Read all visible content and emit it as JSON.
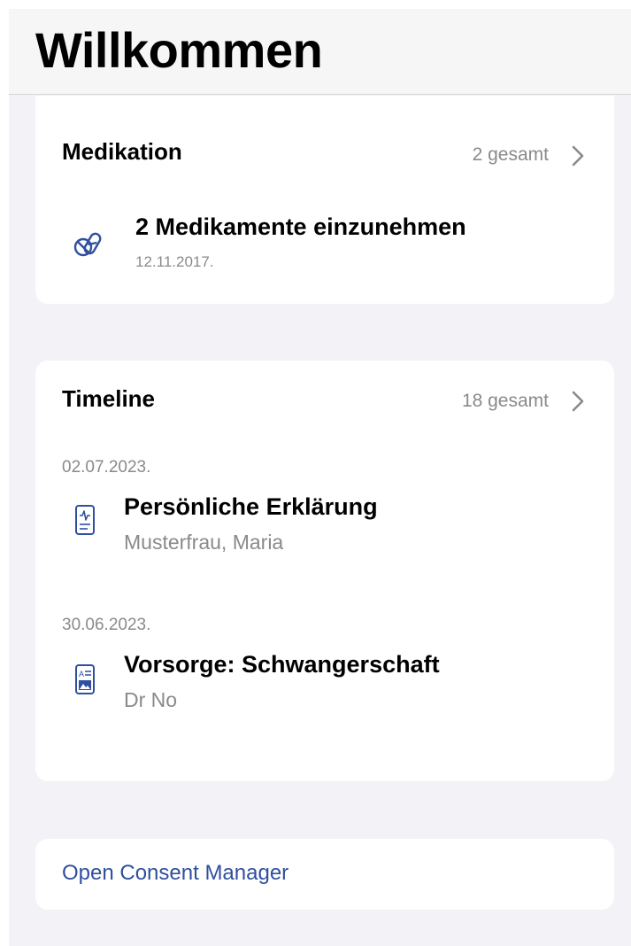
{
  "header": {
    "title": "Willkommen"
  },
  "medication": {
    "title": "Medikation",
    "count": "2 gesamt",
    "item": {
      "icon": "pills-icon",
      "title": "2 Medikamente einzunehmen",
      "date": "12.11.2017."
    }
  },
  "timeline": {
    "title": "Timeline",
    "count": "18 gesamt",
    "entries": [
      {
        "date": "02.07.2023.",
        "icon": "document-heartbeat-icon",
        "title": "Persönliche Erklärung",
        "subtitle": "Musterfrau, Maria"
      },
      {
        "date": "30.06.2023.",
        "icon": "document-image-icon",
        "title": "Vorsorge: Schwangerschaft",
        "subtitle": "Dr No"
      }
    ]
  },
  "consent": {
    "label": "Open Consent Manager"
  },
  "colors": {
    "background": "#f2f2f7",
    "card": "#ffffff",
    "accent": "#2f4f9f",
    "secondary_text": "#8a8a8e"
  }
}
